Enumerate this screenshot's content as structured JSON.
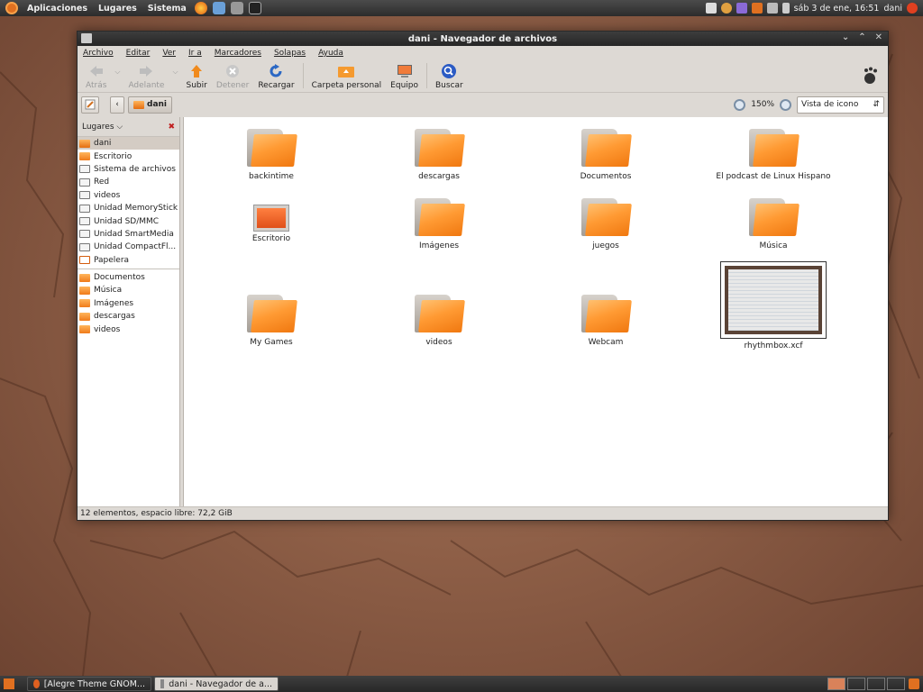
{
  "top_panel": {
    "menus": [
      "Aplicaciones",
      "Lugares",
      "Sistema"
    ],
    "clock": "sáb  3 de ene, 16:51",
    "user": "dani"
  },
  "window": {
    "title": "dani - Navegador de archivos",
    "menu": [
      "Archivo",
      "Editar",
      "Ver",
      "Ir a",
      "Marcadores",
      "Solapas",
      "Ayuda"
    ],
    "toolbar": {
      "back": "Atrás",
      "forward": "Adelante",
      "up": "Subir",
      "stop": "Detener",
      "reload": "Recargar",
      "home": "Carpeta personal",
      "computer": "Equipo",
      "search": "Buscar"
    },
    "location": {
      "current": "dani",
      "zoom": "150%",
      "view_mode": "Vista de icono"
    },
    "sidebar": {
      "header": "Lugares",
      "places": [
        {
          "label": "dani",
          "icon": "home"
        },
        {
          "label": "Escritorio",
          "icon": "folder"
        },
        {
          "label": "Sistema de archivos",
          "icon": "drive"
        },
        {
          "label": "Red",
          "icon": "drive"
        },
        {
          "label": "videos",
          "icon": "drive"
        },
        {
          "label": "Unidad MemoryStick",
          "icon": "drive"
        },
        {
          "label": "Unidad SD/MMC",
          "icon": "drive"
        },
        {
          "label": "Unidad SmartMedia",
          "icon": "drive"
        },
        {
          "label": "Unidad CompactFl...",
          "icon": "drive"
        },
        {
          "label": "Papelera",
          "icon": "trash"
        }
      ],
      "bookmarks": [
        "Documentos",
        "Música",
        "Imágenes",
        "descargas",
        "videos"
      ]
    },
    "files": [
      {
        "name": "backintime",
        "type": "folder"
      },
      {
        "name": "descargas",
        "type": "folder"
      },
      {
        "name": "Documentos",
        "type": "folder"
      },
      {
        "name": "El podcast de Linux Hispano",
        "type": "folder"
      },
      {
        "name": "Escritorio",
        "type": "desktop"
      },
      {
        "name": "Imágenes",
        "type": "folder"
      },
      {
        "name": "juegos",
        "type": "folder"
      },
      {
        "name": "Música",
        "type": "folder"
      },
      {
        "name": "My Games",
        "type": "folder"
      },
      {
        "name": "videos",
        "type": "folder"
      },
      {
        "name": "Webcam",
        "type": "folder"
      },
      {
        "name": "rhythmbox.xcf",
        "type": "image"
      }
    ],
    "status": "12 elementos, espacio libre: 72,2 GiB"
  },
  "bottom_panel": {
    "tasks": [
      {
        "label": "[Alegre Theme GNOM..."
      },
      {
        "label": "dani - Navegador de a..."
      }
    ]
  }
}
